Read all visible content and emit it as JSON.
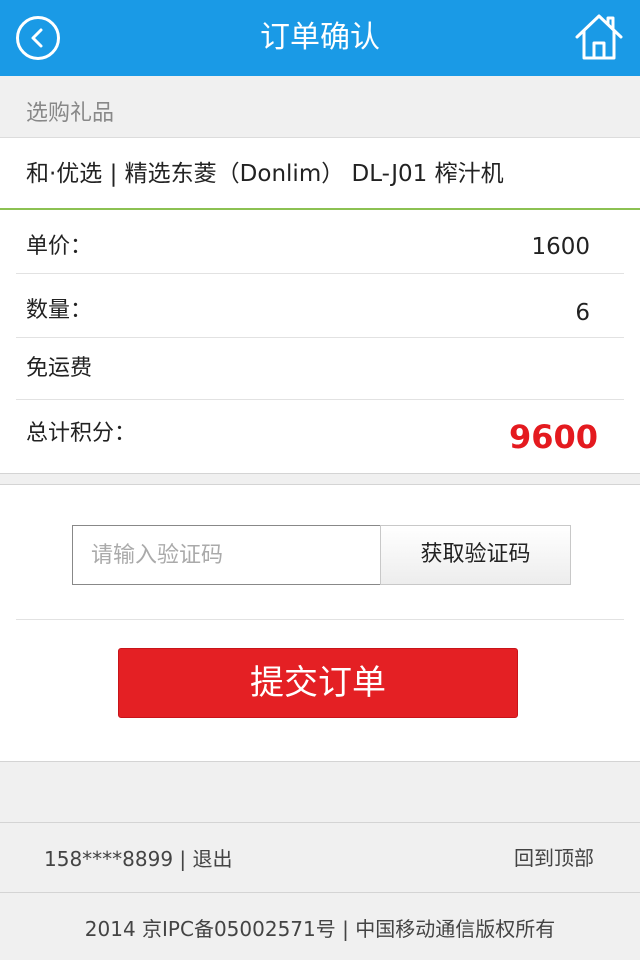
{
  "header": {
    "title": "订单确认",
    "back_icon": "chevron-left-icon",
    "home_icon": "home-icon",
    "color": "#1a9ae6"
  },
  "section": {
    "title": "选购礼品"
  },
  "product": {
    "name": "和·优选 | 精选东菱（Donlim） DL-J01 榨汁机"
  },
  "order": {
    "unit_price_label": "单价：",
    "unit_price": "1600",
    "quantity_label": "数量：",
    "quantity": "6",
    "shipping": "免运费",
    "total_label": "总计积分：",
    "total": "9600",
    "total_color": "#e41a1f"
  },
  "verify": {
    "placeholder": "请输入验证码",
    "value": "",
    "get_code_label": "获取验证码"
  },
  "submit": {
    "label": "提交订单",
    "color": "#e42024"
  },
  "footer": {
    "phone": "158****8899",
    "separator": " | ",
    "logout_label": "退出",
    "back_to_top_label": "回到顶部",
    "copyright": "2014 京IPC备05002571号 | 中国移动通信版权所有"
  }
}
